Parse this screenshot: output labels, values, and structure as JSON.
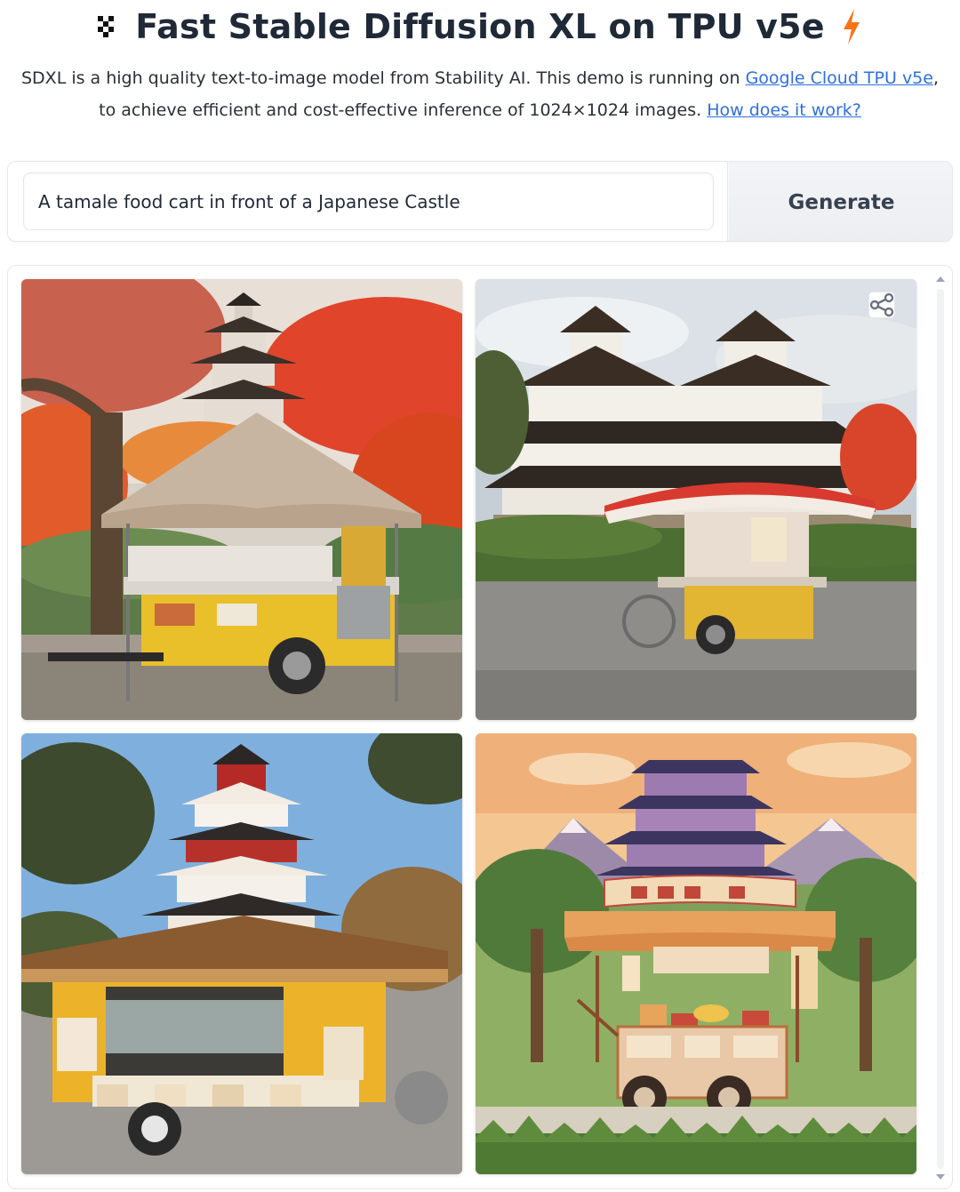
{
  "header": {
    "title": "Fast Stable Diffusion XL on TPU v5e",
    "icon": "pixel-logo-icon",
    "trailing_icon": "lightning-bolt-icon",
    "accent_color": "#f97316"
  },
  "description": {
    "text_1": "SDXL is a high quality text-to-image model from Stability AI. This demo is running on ",
    "link_1": "Google Cloud TPU v5e",
    "text_2": ", to achieve efficient and cost-effective inference of 1024×1024 images. ",
    "link_2": "How does it work?",
    "link_color": "#2f6fe0"
  },
  "prompt": {
    "value": "A tamale food cart in front of a Japanese Castle",
    "generate_label": "Generate"
  },
  "gallery": {
    "share_icon": "share-icon",
    "images": [
      {
        "alt": "generated-image-1",
        "scene": "cart under autumn trees with pagoda"
      },
      {
        "alt": "generated-image-2",
        "scene": "cart with red awning before white castle"
      },
      {
        "alt": "generated-image-3",
        "scene": "yellow cart before tiered castle"
      },
      {
        "alt": "generated-image-4",
        "scene": "illustrated cart before purple castle"
      }
    ]
  }
}
